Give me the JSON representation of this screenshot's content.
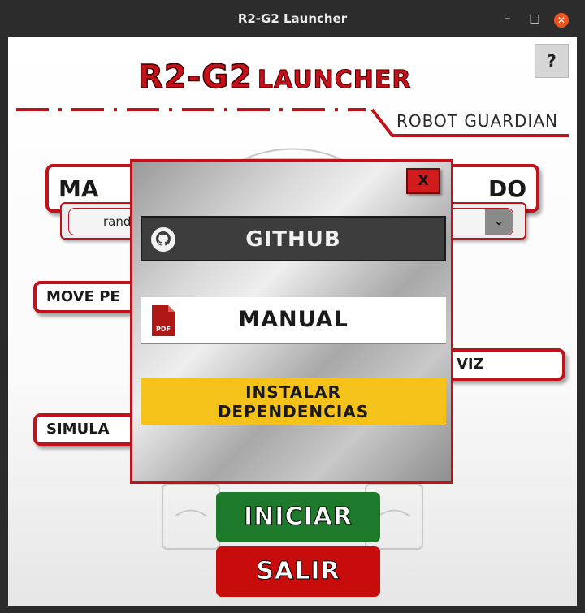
{
  "window": {
    "title": "R2-G2 Launcher"
  },
  "header": {
    "help_label": "?",
    "logo_main": "R2-G2",
    "logo_sub": "LAUNCHER",
    "subtitle": "ROBOT GUARDIAN"
  },
  "background": {
    "map_label_left": "MA",
    "map_label_right": "DO",
    "map_select_value": "rando",
    "move_label": "MOVE PE",
    "viz_label": "VIZ",
    "sim_label": "SIMULA"
  },
  "modal": {
    "close_label": "X",
    "github_label": "GITHUB",
    "manual_label": "MANUAL",
    "pdf_badge": "PDF",
    "install_line1": "INSTALAR",
    "install_line2": "DEPENDENCIAS"
  },
  "actions": {
    "start_label": "INICIAR",
    "exit_label": "SALIR"
  },
  "colors": {
    "accent_red": "#c0121b",
    "start_green": "#1c7a2a",
    "exit_red": "#c80c0c",
    "install_yellow": "#f5c21a",
    "github_dark": "#3d3d3d"
  }
}
